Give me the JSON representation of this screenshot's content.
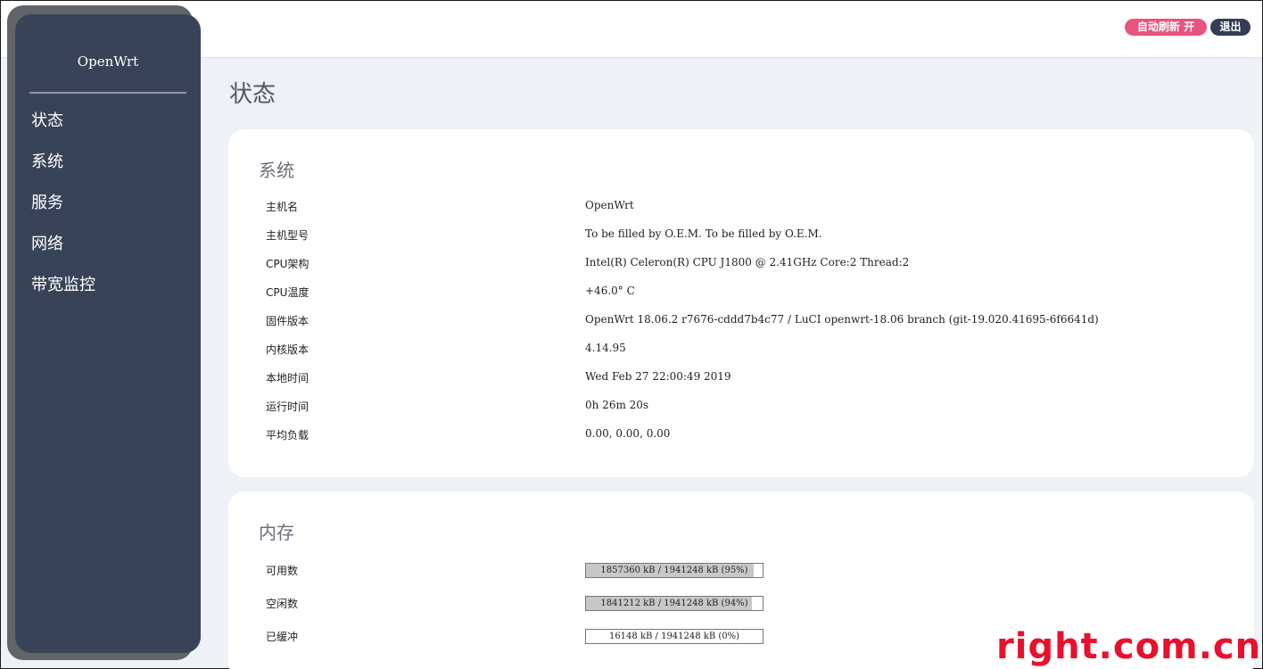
{
  "header": {
    "auto_refresh_label": "自动刷新 开",
    "logout_label": "退出"
  },
  "sidebar": {
    "brand": "OpenWrt",
    "items": [
      {
        "label": "状态"
      },
      {
        "label": "系统"
      },
      {
        "label": "服务"
      },
      {
        "label": "网络"
      },
      {
        "label": "带宽监控"
      }
    ]
  },
  "page": {
    "title": "状态"
  },
  "system": {
    "title": "系统",
    "rows": [
      {
        "label": "主机名",
        "value": "OpenWrt"
      },
      {
        "label": "主机型号",
        "value": "To be filled by O.E.M. To be filled by O.E.M."
      },
      {
        "label": "CPU架构",
        "value": "Intel(R) Celeron(R) CPU J1800 @ 2.41GHz Core:2 Thread:2"
      },
      {
        "label": "CPU温度",
        "value": "+46.0° C"
      },
      {
        "label": "固件版本",
        "value": "OpenWrt 18.06.2 r7676-cddd7b4c77 / LuCI openwrt-18.06 branch (git-19.020.41695-6f6641d)"
      },
      {
        "label": "内核版本",
        "value": "4.14.95"
      },
      {
        "label": "本地时间",
        "value": "Wed Feb 27 22:00:49 2019"
      },
      {
        "label": "运行时间",
        "value": "0h 26m 20s"
      },
      {
        "label": "平均负载",
        "value": "0.00, 0.00, 0.00"
      }
    ]
  },
  "memory": {
    "title": "内存",
    "rows": [
      {
        "label": "可用数",
        "text": "1857360 kB / 1941248 kB (95%)",
        "percent": 95
      },
      {
        "label": "空闲数",
        "text": "1841212 kB / 1941248 kB (94%)",
        "percent": 94
      },
      {
        "label": "已缓冲",
        "text": "16148 kB / 1941248 kB (0%)",
        "percent": 0
      }
    ]
  },
  "watermark": "right.com.cn",
  "colors": {
    "sidebar": "#394358",
    "accent_pink": "#e8547e",
    "logout": "#343d52",
    "background": "#eef1f5",
    "watermark": "#e8112d"
  }
}
